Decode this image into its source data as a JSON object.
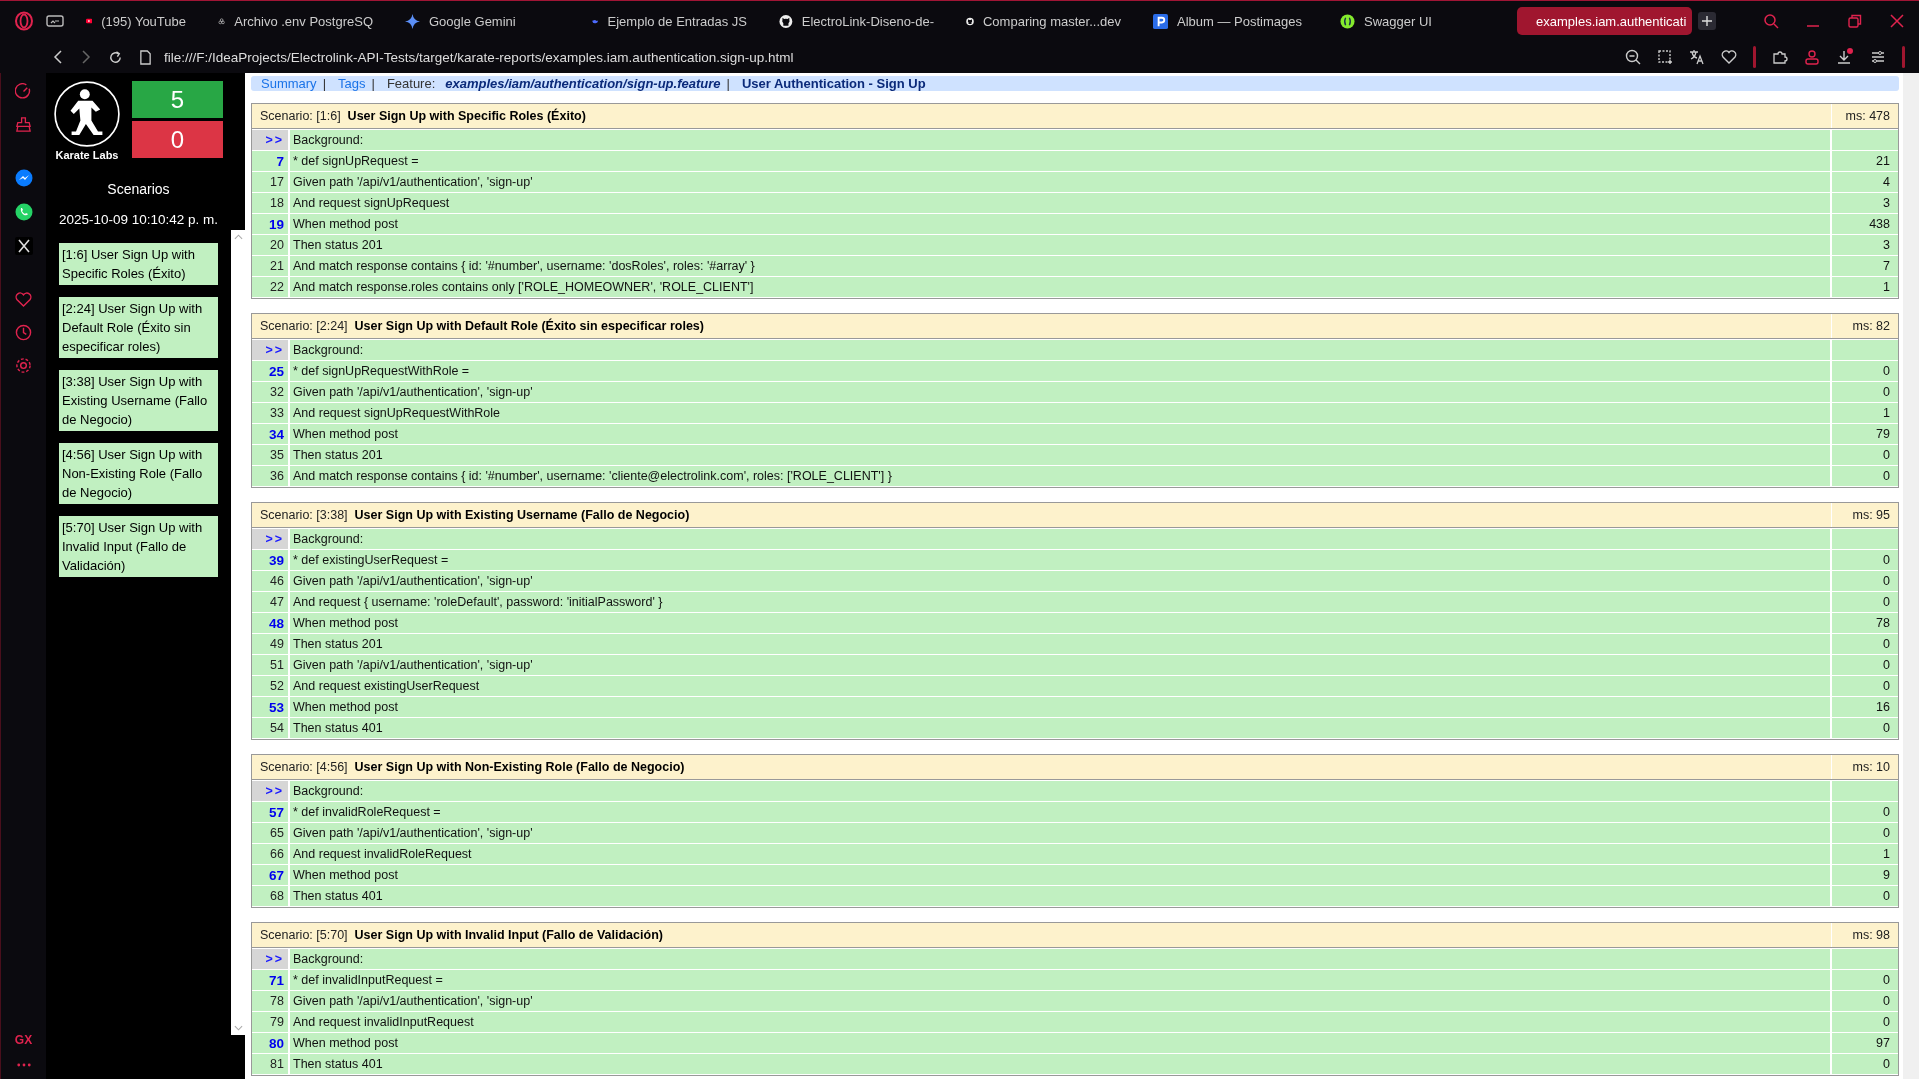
{
  "browser": {
    "tabs": [
      {
        "title": "(195) YouTube",
        "kind": "play",
        "selected": false
      },
      {
        "title": "Archivo .env PostgreSQ",
        "kind": "knot",
        "selected": false
      },
      {
        "title": "Google Gemini",
        "kind": "sparkle",
        "selected": false
      },
      {
        "title": "Ejemplo de Entradas JS",
        "kind": "whale",
        "selected": false
      },
      {
        "title": "ElectroLink-Diseno-de-",
        "kind": "cat",
        "selected": false
      },
      {
        "title": "Comparing master...dev",
        "kind": "cat",
        "selected": false
      },
      {
        "title": "Album — Postimages",
        "kind": "square",
        "selected": false
      },
      {
        "title": "Swagger UI",
        "kind": "globe",
        "selected": false
      },
      {
        "title": "examples.iam.authenticati",
        "kind": "figure",
        "selected": true
      }
    ],
    "address": "file:///F:/IdeaProjects/Electrolink-API-Tests/target/karate-reports/examples.iam.authentication.sign-up.html",
    "brand_mark": "GX"
  },
  "sidebar": {
    "logo_text": "Karate Labs",
    "passed": "5",
    "failed": "0",
    "heading": "Scenarios",
    "timestamp": "2025-10-09 10:10:42 p. m.",
    "items": [
      {
        "label": "[1:6] User Sign Up with Specific Roles (Éxito)",
        "passed": true
      },
      {
        "label": "[2:24] User Sign Up with Default Role (Éxito sin especificar roles)",
        "passed": true
      },
      {
        "label": "[3:38] User Sign Up with Existing Username (Fallo de Negocio)",
        "passed": true
      },
      {
        "label": "[4:56] User Sign Up with Non-Existing Role (Fallo de Negocio)",
        "passed": true
      },
      {
        "label": "[5:70] User Sign Up with Invalid Input (Fallo de Validación)",
        "passed": true
      }
    ]
  },
  "header": [
    {
      "kind": "link",
      "text": "Summary"
    },
    {
      "kind": "sep",
      "text": "|"
    },
    {
      "kind": "link",
      "text": "Tags"
    },
    {
      "kind": "sep",
      "text": "|"
    },
    {
      "kind": "label",
      "text": "Feature:"
    },
    {
      "kind": "path",
      "text": "examples/iam/authentication/sign-up.feature"
    },
    {
      "kind": "sep",
      "text": "|"
    },
    {
      "kind": "name",
      "text": "User Authentication - Sign Up"
    }
  ],
  "scenarios": [
    {
      "label": "Scenario:",
      "ref": "[1:6]",
      "title": "User Sign Up with Specific Roles (Éxito)",
      "ms": "ms: 478",
      "passed": true,
      "steps": [
        {
          "kind": "background",
          "line": ">>",
          "text": "Background:"
        },
        {
          "kind": "call",
          "line": "7",
          "text": "* def signUpRequest =",
          "count": "21"
        },
        {
          "kind": "step",
          "line": "17",
          "text": "Given path '/api/v1/authentication', 'sign-up'",
          "count": "4"
        },
        {
          "kind": "step",
          "line": "18",
          "text": "And request signUpRequest",
          "count": "3"
        },
        {
          "kind": "call",
          "line": "19",
          "text": "When method post",
          "count": "438"
        },
        {
          "kind": "step",
          "line": "20",
          "text": "Then status 201",
          "count": "3"
        },
        {
          "kind": "step",
          "line": "21",
          "text": "And match response contains { id: '#number', username: 'dosRoles', roles: '#array' }",
          "count": "7"
        },
        {
          "kind": "step",
          "line": "22",
          "text": "And match response.roles contains only ['ROLE_HOMEOWNER', 'ROLE_CLIENT']",
          "count": "1"
        }
      ]
    },
    {
      "label": "Scenario:",
      "ref": "[2:24]",
      "title": "User Sign Up with Default Role (Éxito sin especificar roles)",
      "ms": "ms: 82",
      "passed": true,
      "steps": [
        {
          "kind": "background",
          "line": ">>",
          "text": "Background:"
        },
        {
          "kind": "call",
          "line": "25",
          "text": "* def signUpRequestWithRole =",
          "count": "0"
        },
        {
          "kind": "step",
          "line": "32",
          "text": "Given path '/api/v1/authentication', 'sign-up'",
          "count": "0"
        },
        {
          "kind": "step",
          "line": "33",
          "text": "And request signUpRequestWithRole",
          "count": "1"
        },
        {
          "kind": "call",
          "line": "34",
          "text": "When method post",
          "count": "79"
        },
        {
          "kind": "step",
          "line": "35",
          "text": "Then status 201",
          "count": "0"
        },
        {
          "kind": "step",
          "line": "36",
          "text": "And match response contains { id: '#number', username: 'cliente@electrolink.com', roles: ['ROLE_CLIENT'] }",
          "count": "0"
        }
      ]
    },
    {
      "label": "Scenario:",
      "ref": "[3:38]",
      "title": "User Sign Up with Existing Username (Fallo de Negocio)",
      "ms": "ms: 95",
      "passed": true,
      "steps": [
        {
          "kind": "background",
          "line": ">>",
          "text": "Background:"
        },
        {
          "kind": "call",
          "line": "39",
          "text": "* def existingUserRequest =",
          "count": "0"
        },
        {
          "kind": "step",
          "line": "46",
          "text": "Given path '/api/v1/authentication', 'sign-up'",
          "count": "0"
        },
        {
          "kind": "step",
          "line": "47",
          "text": "And request { username: 'roleDefault', password: 'initialPassword' }",
          "count": "0"
        },
        {
          "kind": "call",
          "line": "48",
          "text": "When method post",
          "count": "78"
        },
        {
          "kind": "step",
          "line": "49",
          "text": "Then status 201",
          "count": "0"
        },
        {
          "kind": "step",
          "line": "51",
          "text": "Given path '/api/v1/authentication', 'sign-up'",
          "count": "0"
        },
        {
          "kind": "step",
          "line": "52",
          "text": "And request existingUserRequest",
          "count": "0"
        },
        {
          "kind": "call",
          "line": "53",
          "text": "When method post",
          "count": "16"
        },
        {
          "kind": "step",
          "line": "54",
          "text": "Then status 401",
          "count": "0"
        }
      ]
    },
    {
      "label": "Scenario:",
      "ref": "[4:56]",
      "title": "User Sign Up with Non-Existing Role (Fallo de Negocio)",
      "ms": "ms: 10",
      "passed": true,
      "steps": [
        {
          "kind": "background",
          "line": ">>",
          "text": "Background:"
        },
        {
          "kind": "call",
          "line": "57",
          "text": "* def invalidRoleRequest =",
          "count": "0"
        },
        {
          "kind": "step",
          "line": "65",
          "text": "Given path '/api/v1/authentication', 'sign-up'",
          "count": "0"
        },
        {
          "kind": "step",
          "line": "66",
          "text": "And request invalidRoleRequest",
          "count": "1"
        },
        {
          "kind": "call",
          "line": "67",
          "text": "When method post",
          "count": "9"
        },
        {
          "kind": "step",
          "line": "68",
          "text": "Then status 401",
          "count": "0"
        }
      ]
    },
    {
      "label": "Scenario:",
      "ref": "[5:70]",
      "title": "User Sign Up with Invalid Input (Fallo de Validación)",
      "ms": "ms: 98",
      "passed": true,
      "steps": [
        {
          "kind": "background",
          "line": ">>",
          "text": "Background:"
        },
        {
          "kind": "call",
          "line": "71",
          "text": "* def invalidInputRequest =",
          "count": "0"
        },
        {
          "kind": "step",
          "line": "78",
          "text": "Given path '/api/v1/authentication', 'sign-up'",
          "count": "0"
        },
        {
          "kind": "step",
          "line": "79",
          "text": "And request invalidInputRequest",
          "count": "0"
        },
        {
          "kind": "call",
          "line": "80",
          "text": "When method post",
          "count": "97"
        },
        {
          "kind": "step",
          "line": "81",
          "text": "Then status 401",
          "count": "0"
        }
      ]
    }
  ]
}
